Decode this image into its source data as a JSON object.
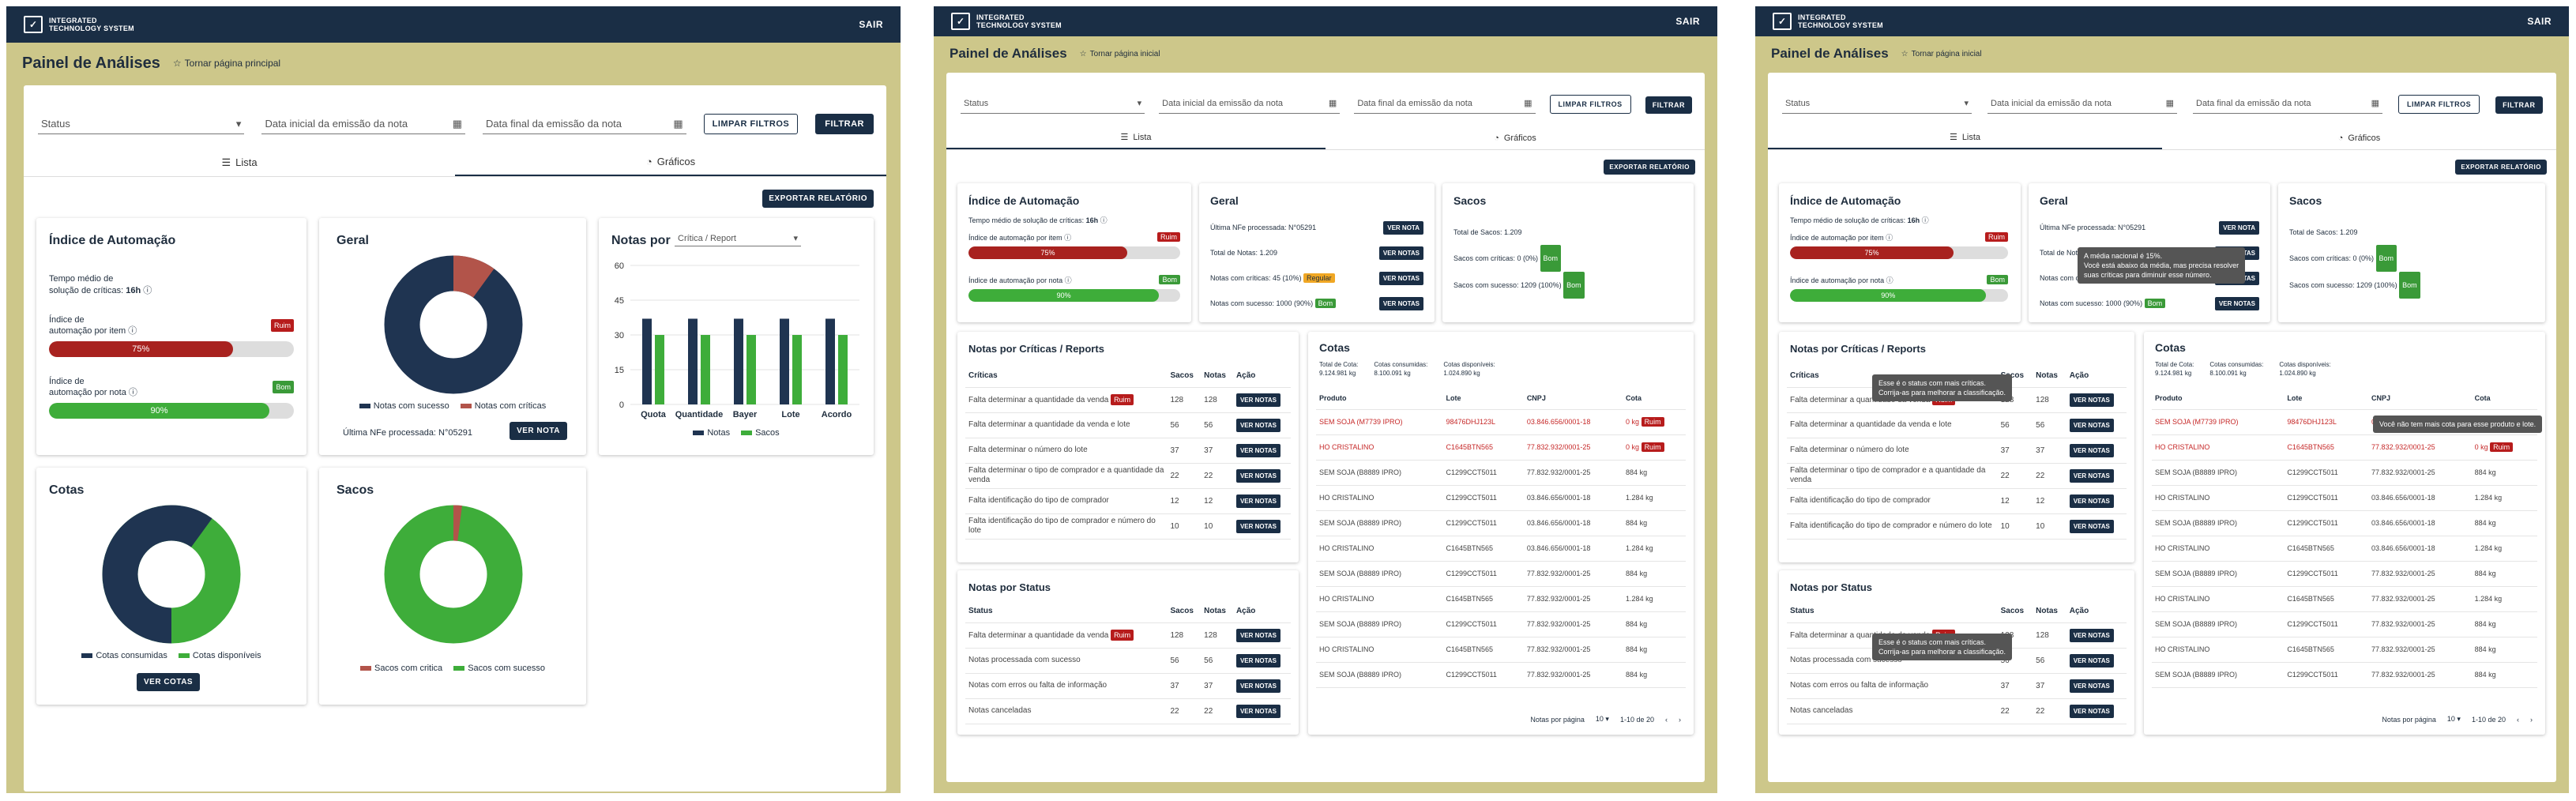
{
  "header": {
    "logo_line1": "INTEGRATED",
    "logo_line2": "TECHNOLOGY SYSTEM",
    "logout": "SAIR"
  },
  "page": {
    "title": "Painel de Análises"
  },
  "screen1": {
    "home_link": "Tornar página principal",
    "filters": {
      "status": "Status",
      "start_date": "Data inicial da emissão da nota",
      "end_date": "Data final da emissão da nota",
      "clear": "LIMPAR FILTROS",
      "apply": "FILTRAR"
    },
    "tabs": {
      "list": "Lista",
      "charts": "Gráficos"
    },
    "export": "EXPORTAR RELATÓRIO",
    "automation": {
      "title": "Índice de Automação",
      "avg_label_1": "Tempo médio de",
      "avg_label_2": "solução de críticas:",
      "avg_value": "16h",
      "item_label_1": "Índice de",
      "item_label_2": "automação por item",
      "item_pct": "75%",
      "item_badge": "Ruim",
      "note_label_1": "Índice de",
      "note_label_2": "automação por nota",
      "note_pct": "90%",
      "note_badge": "Bom"
    },
    "geral": {
      "title": "Geral",
      "legend_success": "Notas com sucesso",
      "legend_critical": "Notas com críticas",
      "last_nfe": "Última NFe processada: N°05291",
      "button": "VER NOTA",
      "success_pct": 0.9
    },
    "notas_chart": {
      "title": "Notas por",
      "select": "Crítica / Report",
      "legend_notas": "Notas",
      "legend_sacos": "Sacos",
      "categories": [
        "Quota",
        "Quantidade",
        "Bayer",
        "Lote",
        "Acordo"
      ],
      "notas": [
        37,
        37,
        37,
        37,
        37
      ],
      "sacos": [
        30,
        30,
        30,
        30,
        30
      ],
      "yticks": [
        "60",
        "45",
        "30",
        "15",
        "0"
      ]
    },
    "cotas": {
      "title": "Cotas",
      "legend_consumed": "Cotas consumidas",
      "legend_available": "Cotas disponíveis",
      "button": "VER COTAS",
      "consumed_pct": 0.6
    },
    "sacos": {
      "title": "Sacos",
      "legend_critical": "Sacos com critica",
      "legend_success": "Sacos com sucesso",
      "critical_pct": 0.02
    }
  },
  "screen2": {
    "home_link": "Tornar página inicial",
    "filters": {
      "status": "Status",
      "start_date": "Data inicial da emissão da nota",
      "end_date": "Data final da emissão da nota",
      "clear": "LIMPAR FILTROS",
      "apply": "FILTRAR"
    },
    "tabs": {
      "list": "Lista",
      "charts": "Gráficos"
    },
    "export": "EXPORTAR RELATÓRIO",
    "automation": {
      "title": "Índice de Automação",
      "avg": "Tempo médio de solução de críticas:",
      "avg_value": "16h",
      "item_label": "Índice de automação por item",
      "item_pct": "75%",
      "item_badge": "Ruim",
      "note_label": "Índice de automação por nota",
      "note_pct": "90%",
      "note_badge": "Bom"
    },
    "geral": {
      "title": "Geral",
      "rows": [
        {
          "label": "Última NFe processada: N°05291",
          "badge": "",
          "btn": "VER NOTA"
        },
        {
          "label": "Total de Notas: 1.209",
          "badge": "",
          "btn": "VER NOTAS"
        },
        {
          "label": "Notas com críticas: 45 (10%)",
          "badge": "Regular",
          "btn": "VER NOTAS"
        },
        {
          "label": "Notas com sucesso: 1000 (90%)",
          "badge": "Bom",
          "btn": "VER NOTAS"
        }
      ]
    },
    "sacos": {
      "title": "Sacos",
      "total": "Total de Sacos: 1.209",
      "critical": "Sacos com críticas: 0 (0%)",
      "critical_badge": "Bom",
      "success": "Sacos com sucesso: 1209 (100%)",
      "success_badge": "Bom"
    },
    "criticas": {
      "title": "Notas por Críticas / Reports",
      "cols": [
        "Críticas",
        "Sacos",
        "Notas",
        "Ação"
      ],
      "rows": [
        {
          "c": "Falta determinar a quantidade da venda",
          "b": "Ruim",
          "s": "128",
          "n": "128"
        },
        {
          "c": "Falta determinar a quantidade da venda e lote",
          "b": "",
          "s": "56",
          "n": "56"
        },
        {
          "c": "Falta determinar o número do lote",
          "b": "",
          "s": "37",
          "n": "37"
        },
        {
          "c": "Falta determinar o tipo de comprador e a quantidade da venda",
          "b": "",
          "s": "22",
          "n": "22"
        },
        {
          "c": "Falta identificação do tipo de comprador",
          "b": "",
          "s": "12",
          "n": "12"
        },
        {
          "c": "Falta identificação do tipo de comprador e número do lote",
          "b": "",
          "s": "10",
          "n": "10"
        }
      ],
      "btn": "VER NOTAS"
    },
    "status": {
      "title": "Notas por Status",
      "cols": [
        "Status",
        "Sacos",
        "Notas",
        "Ação"
      ],
      "rows": [
        {
          "c": "Falta determinar a quantidade da venda",
          "b": "Ruim",
          "s": "128",
          "n": "128"
        },
        {
          "c": "Notas processada com sucesso",
          "b": "",
          "s": "56",
          "n": "56"
        },
        {
          "c": "Notas com erros ou falta de informação",
          "b": "",
          "s": "37",
          "n": "37"
        },
        {
          "c": "Notas canceladas",
          "b": "",
          "s": "22",
          "n": "22"
        }
      ],
      "btn": "VER NOTAS"
    },
    "cotas": {
      "title": "Cotas",
      "total_label": "Total de Cota:",
      "total": "9.124.981 kg",
      "consumed_label": "Cotas consumidas:",
      "consumed": "8.100.091 kg",
      "available_label": "Cotas disponíveis:",
      "available": "1.024.890 kg",
      "cols": [
        "Produto",
        "Lote",
        "CNPJ",
        "Cota"
      ],
      "rows": [
        {
          "p": "SEM SOJA (M7739 IPRO)",
          "l": "98476DHJ123L",
          "c": "03.846.656/0001-18",
          "q": "0 kg",
          "b": "Ruim",
          "red": true
        },
        {
          "p": "HO CRISTALINO",
          "l": "C1645BTN565",
          "c": "77.832.932/0001-25",
          "q": "0 kg",
          "b": "Ruim",
          "red": true
        },
        {
          "p": "SEM SOJA (B8889 IPRO)",
          "l": "C1299CCT5011",
          "c": "77.832.932/0001-25",
          "q": "884 kg",
          "b": "",
          "red": false
        },
        {
          "p": "HO CRISTALINO",
          "l": "C1299CCT5011",
          "c": "03.846.656/0001-18",
          "q": "1.284 kg",
          "b": "",
          "red": false
        },
        {
          "p": "SEM SOJA (B8889 IPRO)",
          "l": "C1299CCT5011",
          "c": "03.846.656/0001-18",
          "q": "884 kg",
          "b": "",
          "red": false
        },
        {
          "p": "HO CRISTALINO",
          "l": "C1645BTN565",
          "c": "03.846.656/0001-18",
          "q": "1.284 kg",
          "b": "",
          "red": false
        },
        {
          "p": "SEM SOJA (B8889 IPRO)",
          "l": "C1299CCT5011",
          "c": "77.832.932/0001-25",
          "q": "884 kg",
          "b": "",
          "red": false
        },
        {
          "p": "HO CRISTALINO",
          "l": "C1645BTN565",
          "c": "77.832.932/0001-25",
          "q": "1.284 kg",
          "b": "",
          "red": false
        },
        {
          "p": "SEM SOJA (B8889 IPRO)",
          "l": "C1299CCT5011",
          "c": "77.832.932/0001-25",
          "q": "884 kg",
          "b": "",
          "red": false
        },
        {
          "p": "HO CRISTALINO",
          "l": "C1645BTN565",
          "c": "77.832.932/0001-25",
          "q": "884 kg",
          "b": "",
          "red": false
        },
        {
          "p": "SEM SOJA (B8889 IPRO)",
          "l": "C1299CCT5011",
          "c": "77.832.932/0001-25",
          "q": "884 kg",
          "b": "",
          "red": false
        }
      ],
      "per_page_label": "Notas por página",
      "per_page": "10",
      "range": "1-10 de 20"
    }
  },
  "screen3": {
    "tooltip_media": [
      "A média nacional é 15%.",
      "Você está abaixo da média, mas precisa resolver",
      "suas críticas para diminuir esse número."
    ],
    "tooltip_status": [
      "Esse é o status com mais críticas.",
      "Corrija-as para melhorar a classificação."
    ],
    "tooltip_cota": "Você não tem mais cota para esse produto e lote."
  }
}
